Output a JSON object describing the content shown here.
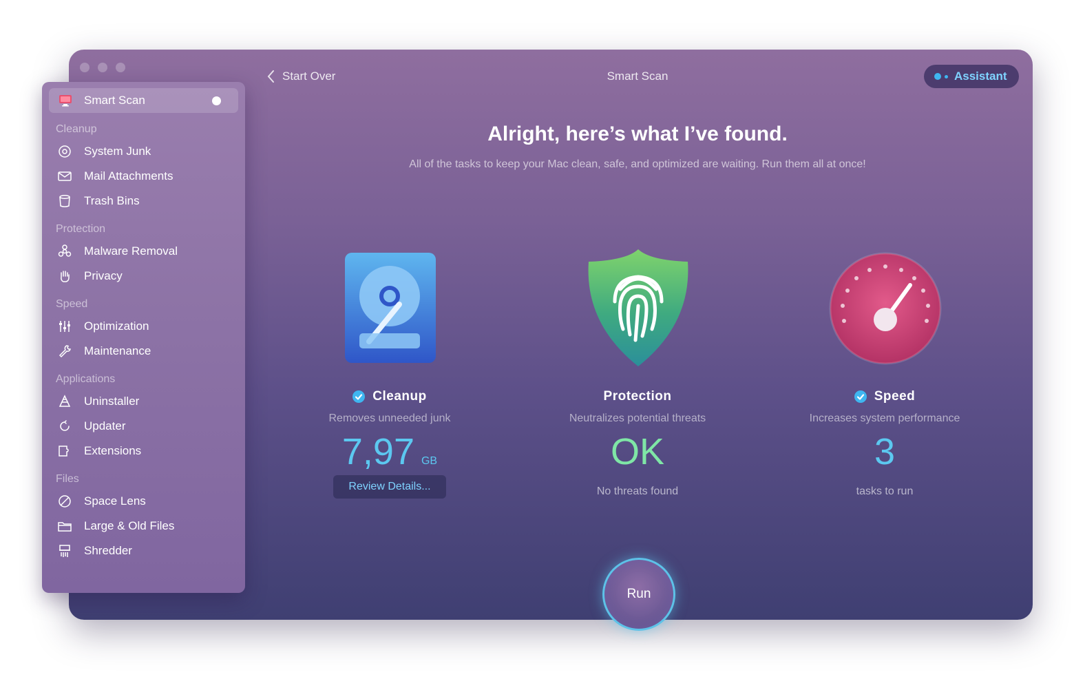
{
  "window": {
    "traffic_lights": [
      "close",
      "minimize",
      "zoom"
    ]
  },
  "sidebar": {
    "active_item": {
      "label": "Smart Scan",
      "icon": "monitor-icon"
    },
    "sections": [
      {
        "title": "Cleanup",
        "items": [
          {
            "label": "System Junk",
            "icon": "system-junk-icon"
          },
          {
            "label": "Mail Attachments",
            "icon": "mail-icon"
          },
          {
            "label": "Trash Bins",
            "icon": "trash-icon"
          }
        ]
      },
      {
        "title": "Protection",
        "items": [
          {
            "label": "Malware Removal",
            "icon": "biohazard-icon"
          },
          {
            "label": "Privacy",
            "icon": "hand-icon"
          }
        ]
      },
      {
        "title": "Speed",
        "items": [
          {
            "label": "Optimization",
            "icon": "sliders-icon"
          },
          {
            "label": "Maintenance",
            "icon": "wrench-icon"
          }
        ]
      },
      {
        "title": "Applications",
        "items": [
          {
            "label": "Uninstaller",
            "icon": "uninstaller-icon"
          },
          {
            "label": "Updater",
            "icon": "updater-icon"
          },
          {
            "label": "Extensions",
            "icon": "extensions-icon"
          }
        ]
      },
      {
        "title": "Files",
        "items": [
          {
            "label": "Space Lens",
            "icon": "space-lens-icon"
          },
          {
            "label": "Large & Old Files",
            "icon": "folder-icon"
          },
          {
            "label": "Shredder",
            "icon": "shredder-icon"
          }
        ]
      }
    ]
  },
  "toolbar": {
    "back_label": "Start Over",
    "title": "Smart Scan",
    "assistant_label": "Assistant"
  },
  "main": {
    "headline": "Alright, here’s what I’ve found.",
    "subline": "All of the tasks to keep your Mac clean, safe, and optimized are waiting. Run them all at once!",
    "cards": {
      "cleanup": {
        "title": "Cleanup",
        "checked": true,
        "description": "Removes unneeded junk",
        "value": "7,97",
        "unit": "GB",
        "button_label": "Review Details...",
        "value_color": "#5cc8f0"
      },
      "protection": {
        "title": "Protection",
        "checked": false,
        "description": "Neutralizes potential threats",
        "value": "OK",
        "note": "No threats found",
        "value_color": "#7fe6a6"
      },
      "speed": {
        "title": "Speed",
        "checked": true,
        "description": "Increases system performance",
        "value": "3",
        "note": "tasks to run",
        "value_color": "#5cc8f0"
      }
    },
    "run_label": "Run"
  },
  "colors": {
    "accent": "#3fb6f0",
    "window_top": "#8f6e9f",
    "window_bottom": "#3f3f72"
  }
}
